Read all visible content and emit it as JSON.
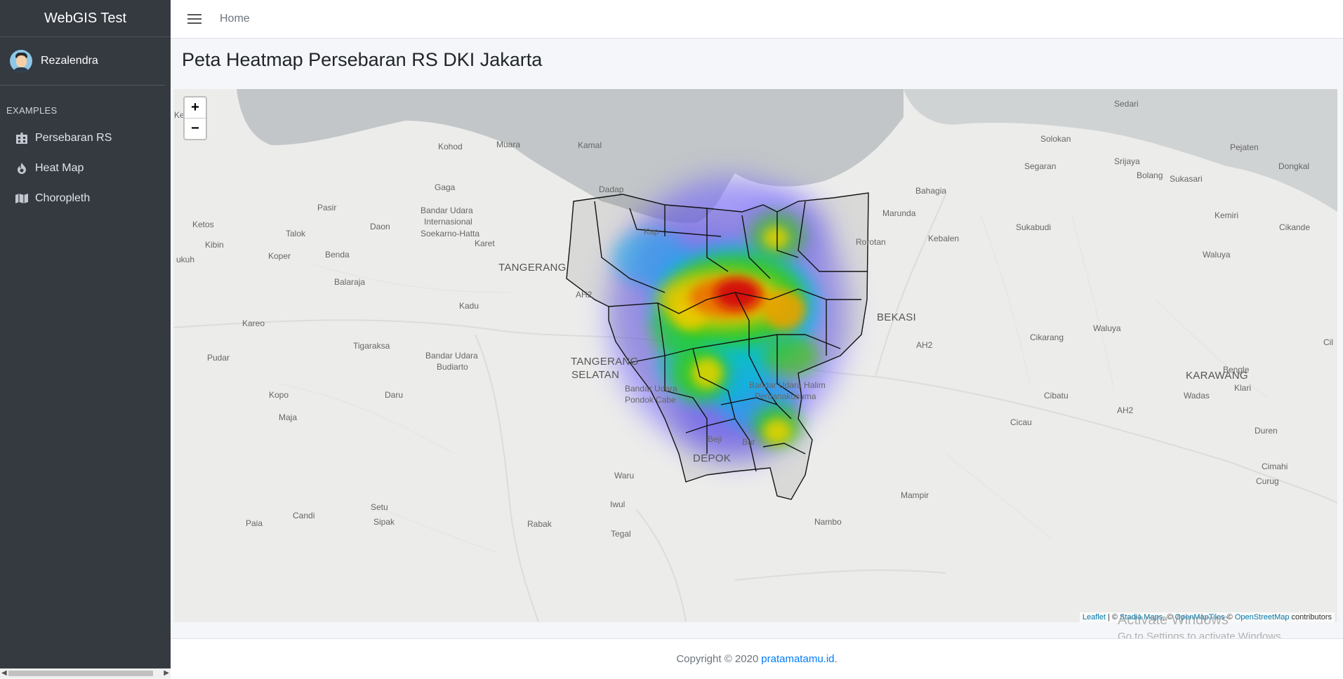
{
  "app": {
    "brand": "WebGIS Test"
  },
  "user": {
    "name": "Rezalendra"
  },
  "sidebar": {
    "header": "EXAMPLES",
    "items": [
      {
        "label": "Persebaran RS",
        "icon": "hospital-icon"
      },
      {
        "label": "Heat Map",
        "icon": "fire-icon"
      },
      {
        "label": "Choropleth",
        "icon": "map-icon"
      }
    ]
  },
  "navbar": {
    "home": "Home"
  },
  "page": {
    "title": "Peta Heatmap Persebaran RS DKI Jakarta"
  },
  "map": {
    "zoom_in": "+",
    "zoom_out": "−",
    "attribution": {
      "leaflet": "Leaflet",
      "sep1": " | © ",
      "stadia": "Stadia Maps",
      "sep2": ", © ",
      "omt": "OpenMapTiles",
      "sep3": " © ",
      "osm": "OpenStreetMap",
      "tail": " contributors"
    },
    "labels": {
      "sedari": "Sedari",
      "solokan": "Solokan",
      "pejaten": "Pejaten",
      "kohod": "Kohod",
      "muara": "Muara",
      "kamal": "Kamal",
      "srijaya": "Srijaya",
      "segaran": "Segaran",
      "dongkal": "Dongkal",
      "bolang": "Bolang",
      "sukasari": "Sukasari",
      "gaga": "Gaga",
      "dadap": "Dadap",
      "bahagia": "Bahagia",
      "pasir": "Pasir",
      "bandar_ut1": "Bandar Udara",
      "internasional": "Internasional",
      "soekarno": "Soekarno-Hatta",
      "marunda": "Marunda",
      "kemiri": "Kemiri",
      "ketos": "Ketos",
      "daon": "Daon",
      "sukabudi": "Sukabudi",
      "cikande": "Cikande",
      "talok": "Talok",
      "kebalen": "Kebalen",
      "kibin": "Kibin",
      "karet": "Karet",
      "rorotan": "Rorotan",
      "waluya1": "Waluya",
      "ukuh": "ukuh",
      "koper": "Koper",
      "benda": "Benda",
      "tangerang": "TANGERANG",
      "balaraja": "Balaraja",
      "ah2_1": "AH2",
      "kadu": "Kadu",
      "bekasi": "BEKASI",
      "kareo": "Kareo",
      "waluya2": "Waluya",
      "halim1": "Bandar Udara Halim",
      "halim2": "Perdanakusuma",
      "ah2_2": "AH2",
      "cikarang": "Cikarang",
      "cil": "Cil",
      "tigaraksa": "Tigaraksa",
      "bu_budiarto1": "Bandar Udara",
      "bu_budiarto2": "Budiarto",
      "pudar": "Pudar",
      "tangsel1": "TANGERANG",
      "tangsel2": "SELATAN",
      "bengle": "Bengle",
      "karawang": "KARAWANG",
      "kopo": "Kopo",
      "daru": "Daru",
      "bu_pc1": "Bandar Udara",
      "bu_pc2": "Pondok Cabe",
      "cibatu": "Cibatu",
      "wadas": "Wadas",
      "klari": "Klari",
      "maja": "Maja",
      "ah2_3": "AH2",
      "cicau": "Cicau",
      "duren": "Duren",
      "beji": "Beji",
      "depok": "DEPOK",
      "cimahi": "Cimahi",
      "waru": "Waru",
      "curug": "Curug",
      "mampir": "Mampir",
      "iwul": "Iwul",
      "setu": "Setu",
      "candi": "Candi",
      "sipak": "Sipak",
      "nambo": "Nambo",
      "paia": "Paia",
      "rabak": "Rabak",
      "tegal": "Tegal",
      "ket": "Ket",
      "kap": "Kap",
      "bar": "Bar"
    }
  },
  "watermark": {
    "line1": "Activate Windows",
    "line2": "Go to Settings to activate Windows."
  },
  "footer": {
    "text": "Copyright © 2020",
    "link": "pratamatamu.id",
    "dot": "."
  }
}
